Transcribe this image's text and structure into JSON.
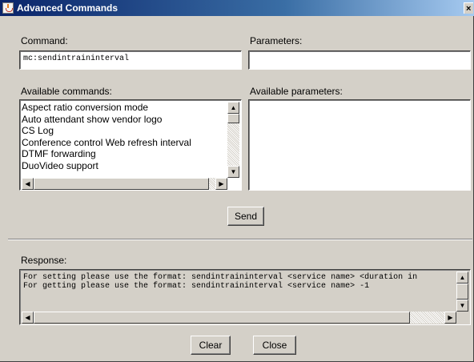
{
  "window": {
    "title": "Advanced Commands",
    "close_glyph": "×",
    "icon": "java-cup-icon"
  },
  "command": {
    "label": "Command:",
    "value": "mc:sendintraininterval"
  },
  "parameters": {
    "label": "Parameters:",
    "value": ""
  },
  "available_commands": {
    "label": "Available commands:",
    "items": [
      "Aspect ratio conversion mode",
      "Auto attendant show vendor logo",
      "CS Log",
      "Conference control Web refresh interval",
      "DTMF forwarding",
      "DuoVideo support"
    ]
  },
  "available_parameters": {
    "label": "Available parameters:",
    "items": []
  },
  "send_button": "Send",
  "response": {
    "label": "Response:",
    "lines": [
      "For setting please use the format: sendintraininterval <service name> <duration in",
      "For getting please use the format: sendintraininterval <service name> -1"
    ]
  },
  "footer": {
    "clear_label": "Clear",
    "close_label": "Close"
  },
  "colors": {
    "face": "#d4d0c8",
    "title_start": "#0a246a",
    "title_end": "#a6caf0"
  }
}
